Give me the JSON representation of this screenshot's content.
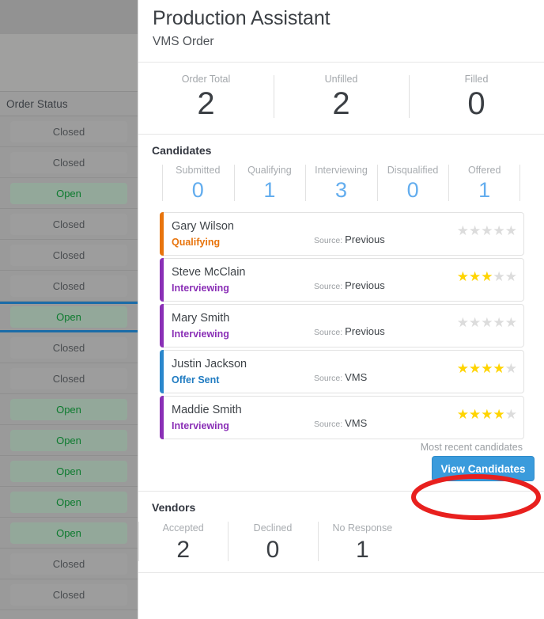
{
  "background_grid": {
    "column_header": "Order Status",
    "rows": [
      {
        "status": "Closed"
      },
      {
        "status": "Closed"
      },
      {
        "status": "Open"
      },
      {
        "status": "Closed"
      },
      {
        "status": "Closed"
      },
      {
        "status": "Closed"
      },
      {
        "status": "Open"
      },
      {
        "status": "Closed"
      },
      {
        "status": "Closed"
      },
      {
        "status": "Open"
      },
      {
        "status": "Open"
      },
      {
        "status": "Open"
      },
      {
        "status": "Open"
      },
      {
        "status": "Open"
      },
      {
        "status": "Closed"
      },
      {
        "status": "Closed"
      }
    ],
    "selected_row_index": 6
  },
  "panel": {
    "title": "Production Assistant",
    "subtitle": "VMS Order",
    "order_stats": [
      {
        "label": "Order Total",
        "value": "2"
      },
      {
        "label": "Unfilled",
        "value": "2"
      },
      {
        "label": "Filled",
        "value": "0"
      }
    ],
    "candidates": {
      "heading": "Candidates",
      "stats": [
        {
          "label": "Submitted",
          "value": "0"
        },
        {
          "label": "Qualifying",
          "value": "1"
        },
        {
          "label": "Interviewing",
          "value": "3"
        },
        {
          "label": "Disqualified",
          "value": "0"
        },
        {
          "label": "Offered",
          "value": "1"
        }
      ],
      "list": [
        {
          "name": "Gary Wilson",
          "status": "Qualifying",
          "status_color": "#e8740c",
          "accent": "#e8740c",
          "source_label": "Source:",
          "source": "Previous",
          "rating": 0
        },
        {
          "name": "Steve McClain",
          "status": "Interviewing",
          "status_color": "#8a2fb6",
          "accent": "#8a2fb6",
          "source_label": "Source:",
          "source": "Previous",
          "rating": 3
        },
        {
          "name": "Mary Smith",
          "status": "Interviewing",
          "status_color": "#8a2fb6",
          "accent": "#8a2fb6",
          "source_label": "Source:",
          "source": "Previous",
          "rating": 0
        },
        {
          "name": "Justin Jackson",
          "status": "Offer Sent",
          "status_color": "#1f7bc1",
          "accent": "#2a87cc",
          "source_label": "Source:",
          "source": "VMS",
          "rating": 4
        },
        {
          "name": "Maddie Smith",
          "status": "Interviewing",
          "status_color": "#8a2fb6",
          "accent": "#8a2fb6",
          "source_label": "Source:",
          "source": "VMS",
          "rating": 4
        }
      ],
      "recent_note": "Most recent candidates",
      "view_button": "View Candidates"
    },
    "vendors": {
      "heading": "Vendors",
      "stats": [
        {
          "label": "Accepted",
          "value": "2"
        },
        {
          "label": "Declined",
          "value": "0"
        },
        {
          "label": "No Response",
          "value": "1"
        }
      ]
    }
  },
  "annotation": {
    "shape": "ellipse-highlight",
    "color": "#e8201e"
  },
  "colors": {
    "accent_blue": "#3a9bdc",
    "stat_blue": "#63adee",
    "open_green": "#0c7a2e",
    "annotation_red": "#e8201e"
  }
}
